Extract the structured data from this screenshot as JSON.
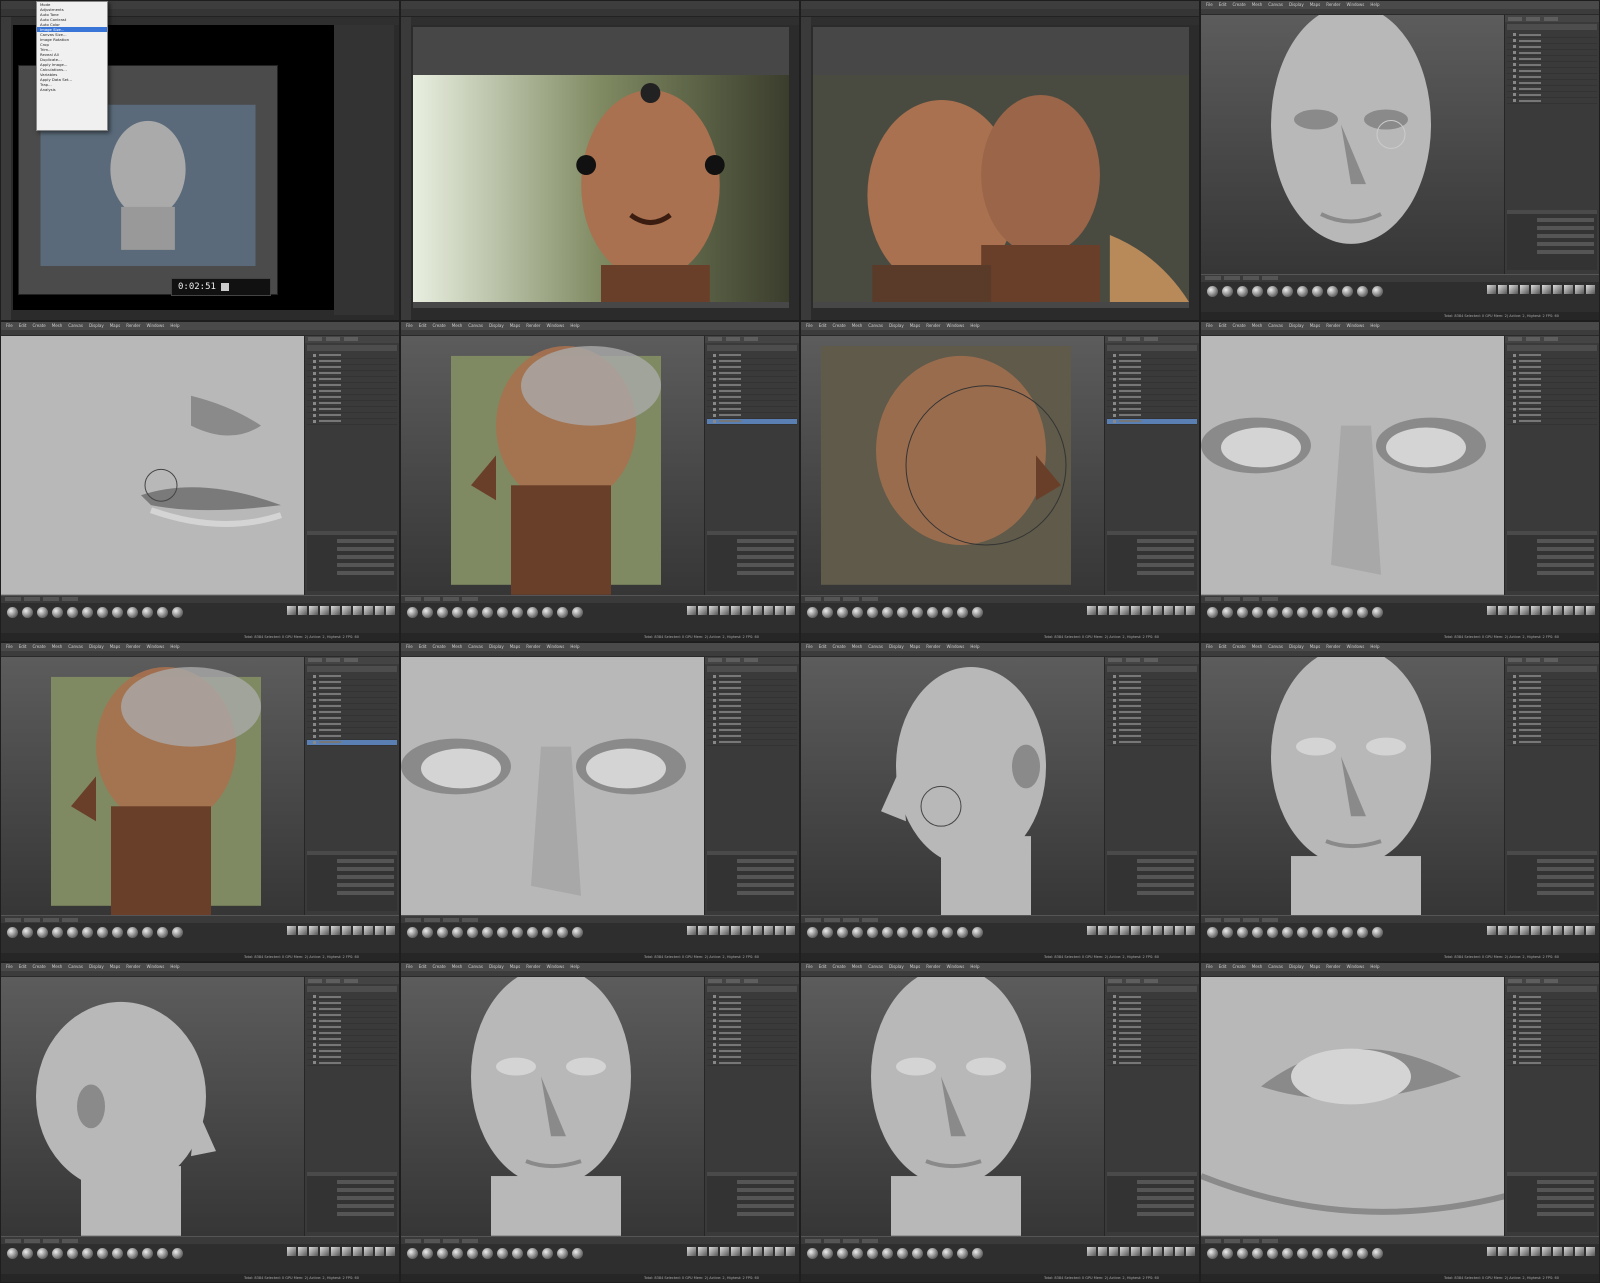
{
  "screenshot": {
    "timer": "0:02:51"
  },
  "ps_menu": {
    "items": [
      "Mode",
      "Adjustments",
      "Auto Tone",
      "Auto Contrast",
      "Auto Color",
      "Image Size...",
      "Canvas Size...",
      "Image Rotation",
      "Crop",
      "Trim...",
      "Reveal All",
      "Duplicate...",
      "Apply Image...",
      "Calculations...",
      "Variables",
      "Apply Data Set...",
      "Trap...",
      "Analysis"
    ],
    "highlighted_index": 5
  },
  "app": {
    "menus": [
      "File",
      "Edit",
      "Create",
      "Mesh",
      "Canvas",
      "Display",
      "Maps",
      "Render",
      "Windows",
      "Help"
    ],
    "tabs": [
      "UV Tab",
      "Image Browser"
    ],
    "panel_tabs": [
      "Layers",
      "Object List",
      "Viewport Filters"
    ],
    "tray_tabs": [
      "Sculpt Tools",
      "Paint Tools",
      "Pose Tools",
      "Select/Move Tools"
    ],
    "status": "Total: 8384  Selected: 0  GPU Mem: 2(  Active: 2, Highest: 2  FPS: 60"
  },
  "photos": {
    "colors": {
      "skin": "#a9714f",
      "skin_dark": "#6a3f2a",
      "bg_green": "#7f8a62",
      "sculpt": "#b4b4b4"
    }
  }
}
